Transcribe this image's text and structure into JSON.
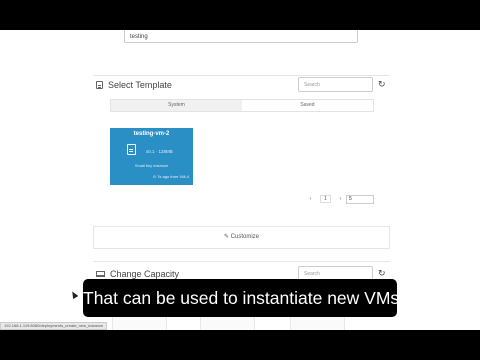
{
  "form": {
    "name_value": "testing"
  },
  "select_template": {
    "title": "Select Template",
    "icon": "document-icon",
    "search_placeholder": "Search",
    "tabs": [
      {
        "label": "System",
        "active": false
      },
      {
        "label": "Saved",
        "active": true
      }
    ],
    "templates": [
      {
        "name": "testing-vm-2",
        "specs": "x0.1 · 128MB",
        "description": "Small tiny instance",
        "meta": "⊙ 7s ago from VM-4",
        "color": "#2a8fc4"
      }
    ],
    "pagination": {
      "prev": "‹",
      "current": "1",
      "next": "›",
      "per_page": "5"
    },
    "customize_label": "✎ Customize"
  },
  "change_capacity": {
    "title": "Change Capacity",
    "icon": "laptop-icon",
    "search_placeholder": "Search"
  },
  "status_bar": {
    "url": "192.168.1.119:8080/deployments_create_new_instance"
  },
  "caption": {
    "text": "That can be used to instantiate new VMs"
  }
}
